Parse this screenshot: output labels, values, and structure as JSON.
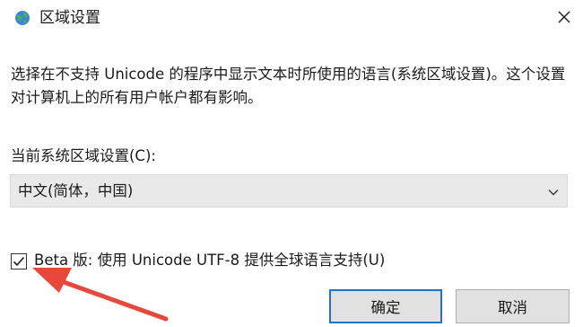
{
  "dialog": {
    "title": "区域设置",
    "close_icon": "close-icon",
    "app_icon": "globe-icon"
  },
  "description": "选择在不支持 Unicode 的程序中显示文本时所使用的语言(系统区域设置)。这个设置对计算机上的所有用户帐户都有影响。",
  "locale": {
    "label": "当前系统区域设置(C):",
    "selected_value": "中文(简体，中国)",
    "dropdown_icon": "chevron-down-icon"
  },
  "beta_option": {
    "label": "Beta 版: 使用 Unicode UTF-8 提供全球语言支持(U)",
    "checked": true
  },
  "buttons": {
    "ok_label": "确定",
    "cancel_label": "取消"
  },
  "colors": {
    "annotation_arrow": "#e8483c",
    "primary_button_border": "#2472c8",
    "select_background": "#e9e9e9"
  }
}
